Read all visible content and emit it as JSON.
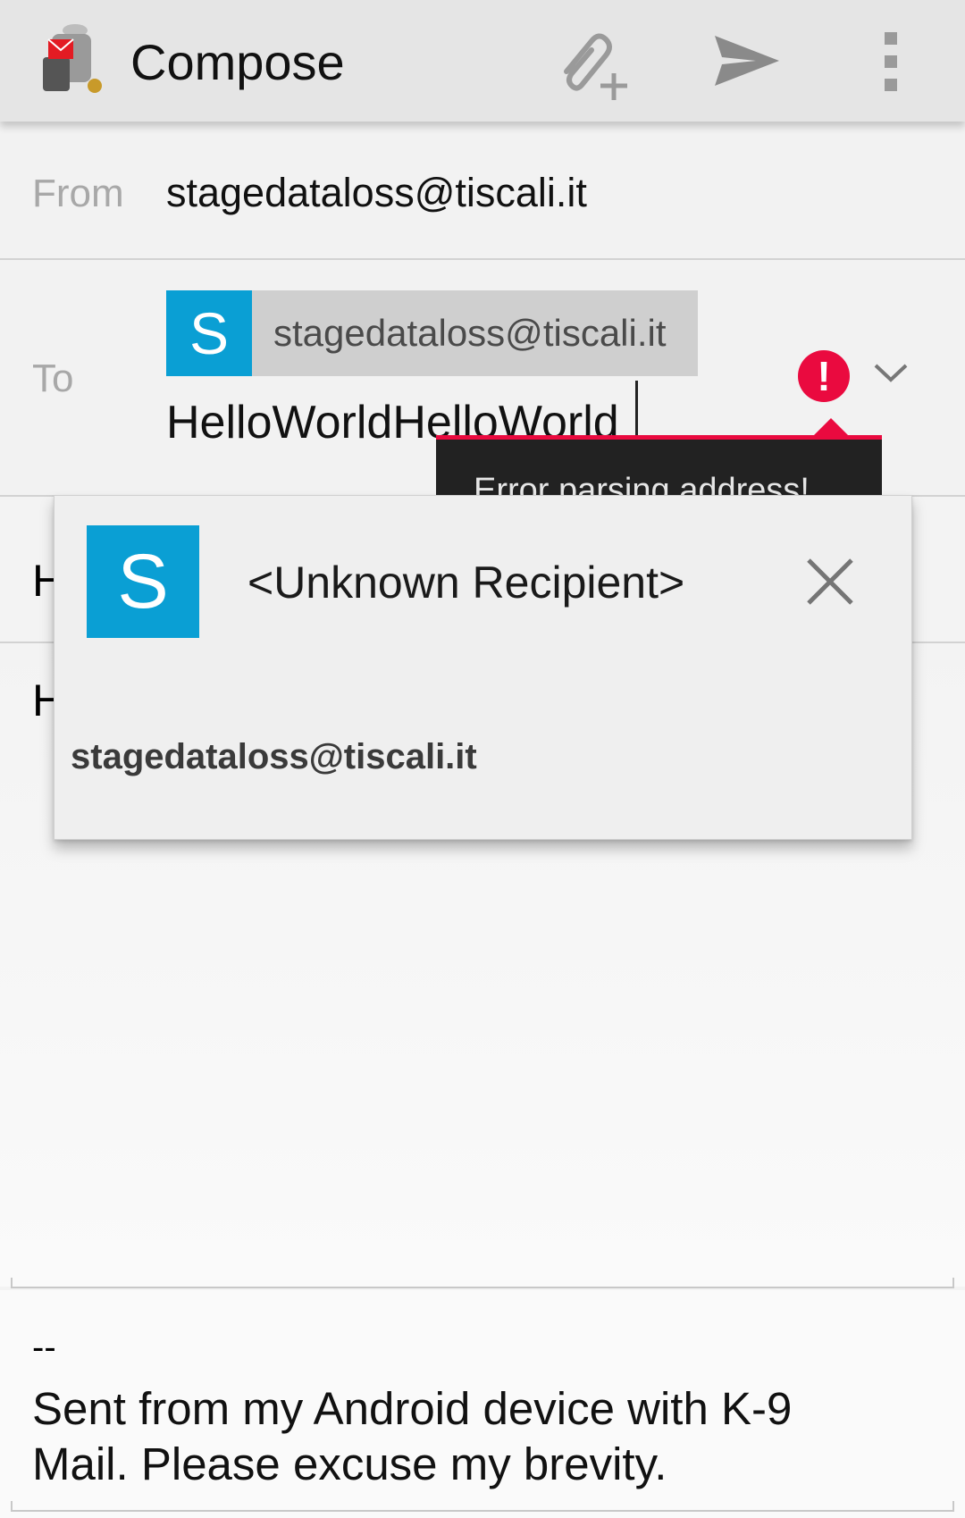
{
  "appbar": {
    "title": "Compose",
    "icons": [
      "app-logo-icon",
      "attach-icon",
      "send-icon",
      "overflow-menu-icon"
    ]
  },
  "from": {
    "label": "From",
    "value": "stagedataloss@tiscali.it"
  },
  "to": {
    "label": "To",
    "chip": {
      "avatar_letter": "S",
      "address": "stagedataloss@tiscali.it"
    },
    "input_value": "HelloWorldHelloWorld",
    "error_message": "Error parsing address!"
  },
  "subject": {
    "visible_text": "H"
  },
  "body": {
    "visible_text": "H"
  },
  "signature": {
    "dashes": "--",
    "text": "Sent from my Android device with K-9 Mail. Please excuse my brevity."
  },
  "suggestion": {
    "avatar_letter": "S",
    "name": "<Unknown Recipient>",
    "email": "stagedataloss@tiscali.it"
  },
  "colors": {
    "accent": "#0a9fd4",
    "error": "#ea0a3f",
    "appbar": "#e5e5e5"
  }
}
